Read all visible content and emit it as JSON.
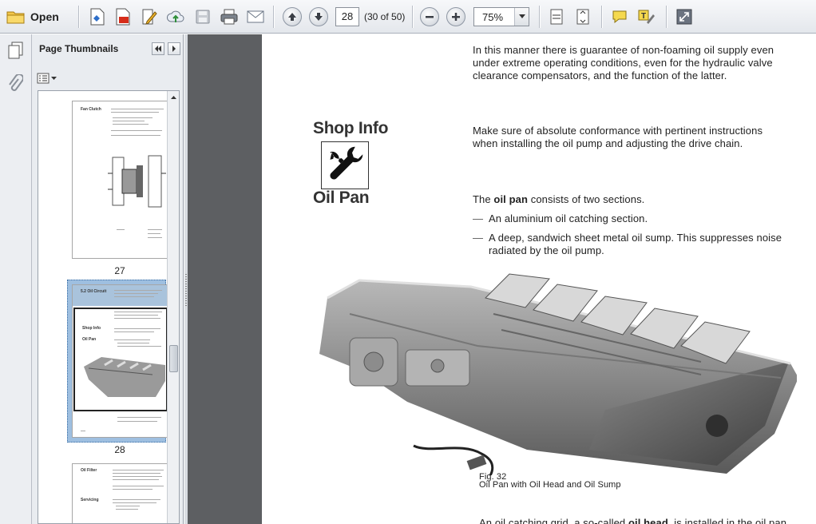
{
  "toolbar": {
    "open_label": "Open",
    "page_number": "28",
    "page_count": "(30 of 50)",
    "zoom": "75%"
  },
  "panel": {
    "title": "Page Thumbnails",
    "thumbnails": [
      {
        "label": "27",
        "heading": "Fan Clutch"
      },
      {
        "label": "28",
        "heading": "5.2 Oil Circuit",
        "sub1": "Shop Info",
        "sub2": "Oil Pan"
      },
      {
        "label": "",
        "heading": "Oil Filter",
        "sub1": "Servicing"
      }
    ]
  },
  "document": {
    "para1": [
      "In this manner there is guarantee of non-foaming oil supply even",
      "under extreme operating conditions, even for the hydraulic valve",
      "clearance compensators, and the function of the latter."
    ],
    "shop_info_heading": "Shop Info",
    "shop_info_text": [
      "Make sure of absolute conformance with pertinent instructions",
      "when installing the oil pump and adjusting the drive chain."
    ],
    "oil_pan_heading": "Oil Pan",
    "oil_pan_intro_pre": "The ",
    "oil_pan_intro_bold": "oil pan",
    "oil_pan_intro_post": " consists of two sections.",
    "bullet1": "An aluminium oil catching section.",
    "bullet2": [
      "A deep, sandwich sheet metal oil sump. This suppresses noise",
      "radiated by the oil pump."
    ],
    "fig_number": "Fig. 32",
    "fig_caption": "Oil Pan with Oil Head and Oil Sump",
    "bottom_pre": "An oil catching grid, a so-called ",
    "bottom_bold": "oil head",
    "bottom_post": ", is installed in the oil pan"
  },
  "colors": {
    "toolbar_bg": "#e4e7ec",
    "doc_background": "#5d5f62",
    "selection": "#9ebfe0"
  }
}
